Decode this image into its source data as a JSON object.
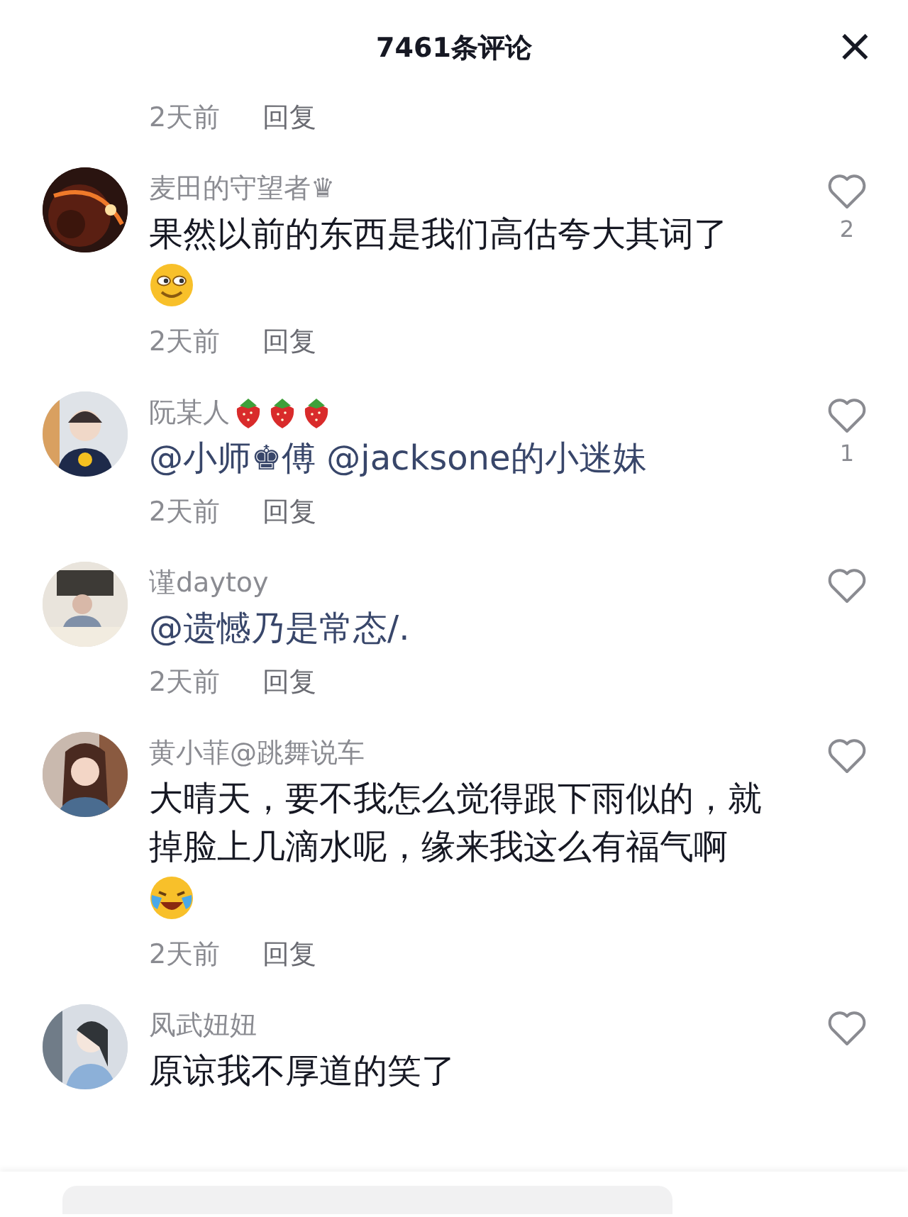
{
  "header": {
    "title": "7461条评论",
    "close": "×"
  },
  "partial_comment": {
    "time": "2天前",
    "reply": "回复"
  },
  "comments": [
    {
      "name": "麦田的守望者♛",
      "kind": "plain",
      "text": "果然以前的东西是我们高估夸大其词了",
      "emoji": {
        "kind": "smile"
      },
      "likes": "2",
      "time": "2天前",
      "reply": "回复"
    },
    {
      "name": "阮某人",
      "badges": [
        {
          "kind": "strawberry"
        },
        {
          "kind": "strawberry"
        },
        {
          "kind": "strawberry"
        }
      ],
      "kind": "mention",
      "text": "@小师♚傅 @jacksone的小迷妹",
      "likes": "1",
      "time": "2天前",
      "reply": "回复"
    },
    {
      "name": "谨daytoy",
      "kind": "mention",
      "text": "@遗憾乃是常态/.",
      "time": "2天前",
      "reply": "回复"
    },
    {
      "name": "黄小菲@跳舞说车",
      "kind": "plain",
      "text": "大晴天，要不我怎么觉得跟下雨似的，就掉脸上几滴水呢，缘来我这么有福气啊",
      "emoji": {
        "kind": "laughcry"
      },
      "time": "2天前",
      "reply": "回复"
    },
    {
      "name": "凤武妞妞",
      "kind": "plain",
      "text": "原谅我不厚道的笑了"
    }
  ]
}
